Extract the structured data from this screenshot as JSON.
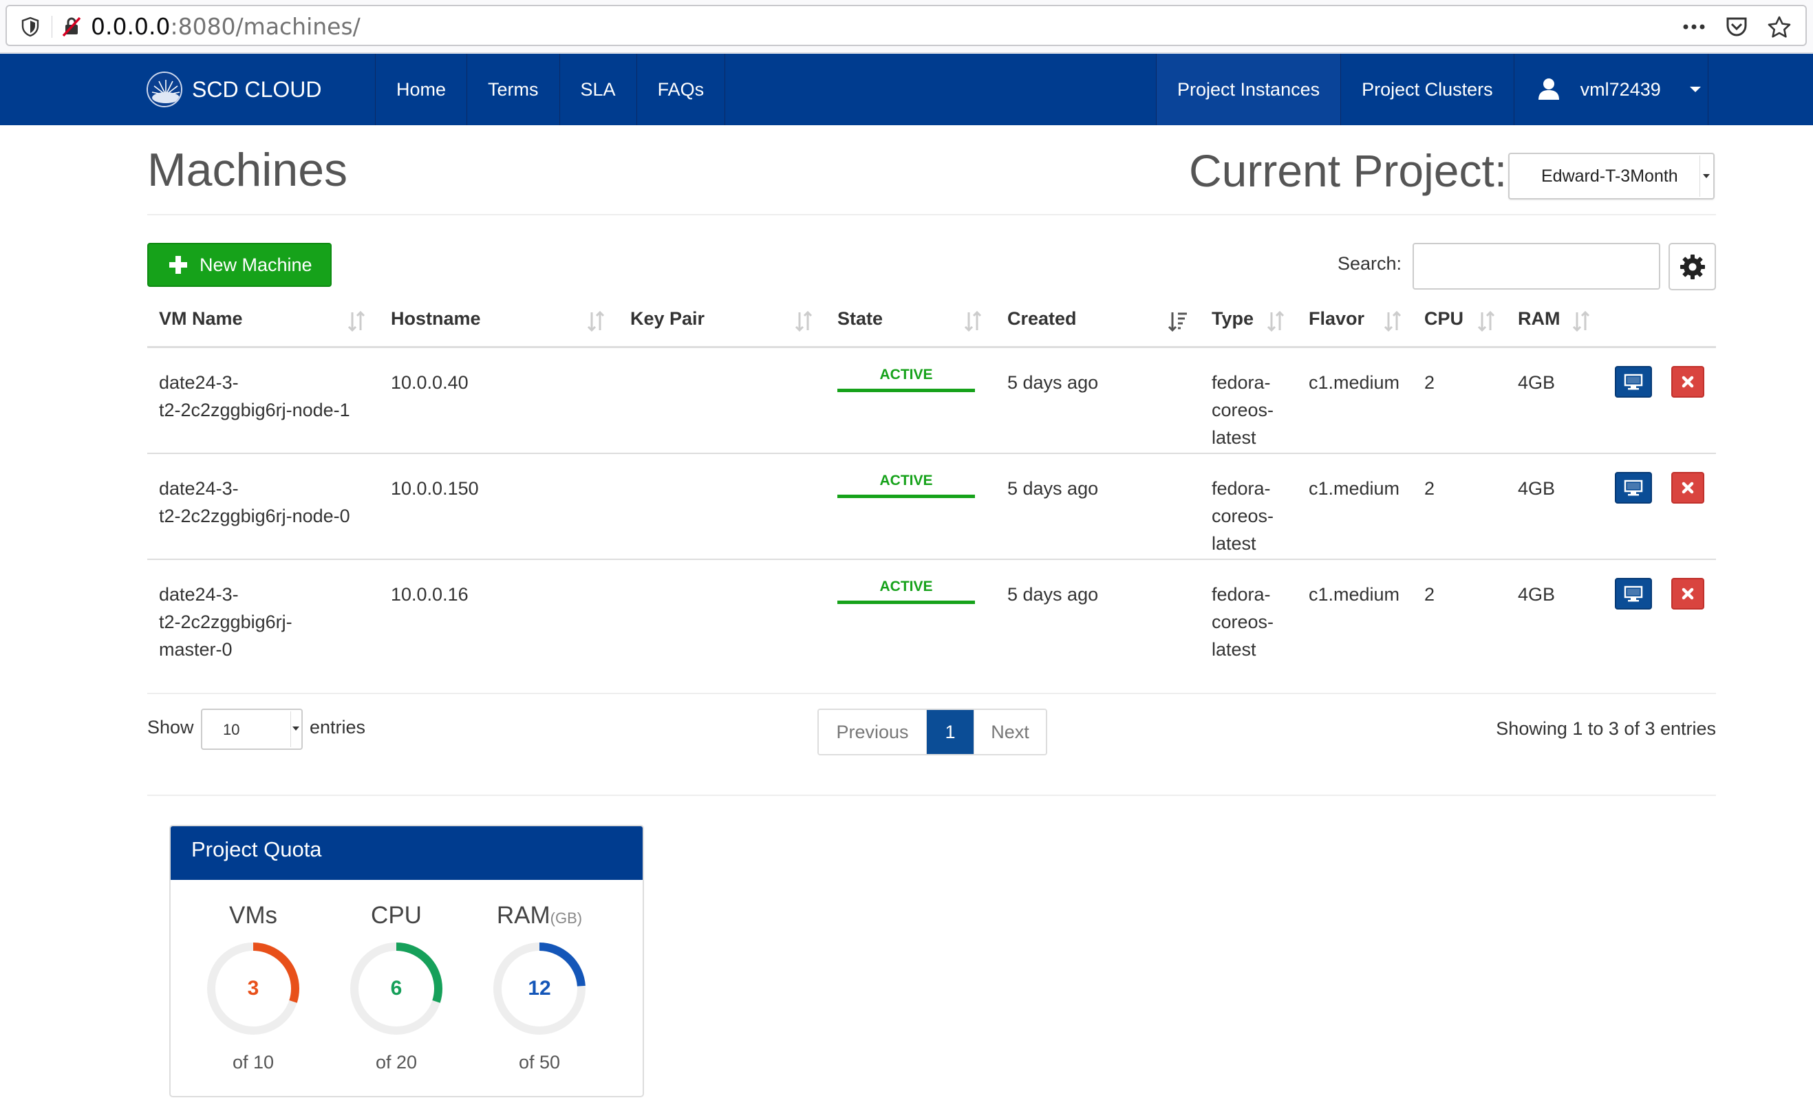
{
  "browser": {
    "url_host": "0.0.0.0",
    "url_rest": ":8080/machines/"
  },
  "navbar": {
    "brand": "SCD CLOUD",
    "left_items": [
      "Home",
      "Terms",
      "SLA",
      "FAQs"
    ],
    "right_items": [
      "Project Instances",
      "Project Clusters"
    ],
    "username": "vml72439"
  },
  "page": {
    "title": "Machines",
    "project_label": "Current Project:",
    "project_value": "Edward-T-3Month"
  },
  "toolbar": {
    "new_machine_label": "New Machine",
    "search_label": "Search:",
    "search_value": ""
  },
  "table": {
    "columns": [
      "VM Name",
      "Hostname",
      "Key Pair",
      "State",
      "Created",
      "Type",
      "Flavor",
      "CPU",
      "RAM"
    ],
    "rows": [
      {
        "vm_name": [
          "date24-3-",
          "t2-2c2zggbig6rj-node-1"
        ],
        "hostname": "10.0.0.40",
        "key_pair": "",
        "state": "ACTIVE",
        "created": "5 days ago",
        "type": [
          "fedora-",
          "coreos-",
          "latest"
        ],
        "flavor": "c1.medium",
        "cpu": "2",
        "ram": "4GB"
      },
      {
        "vm_name": [
          "date24-3-",
          "t2-2c2zggbig6rj-node-0"
        ],
        "hostname": "10.0.0.150",
        "key_pair": "",
        "state": "ACTIVE",
        "created": "5 days ago",
        "type": [
          "fedora-",
          "coreos-",
          "latest"
        ],
        "flavor": "c1.medium",
        "cpu": "2",
        "ram": "4GB"
      },
      {
        "vm_name": [
          "date24-3-",
          "t2-2c2zggbig6rj-",
          "master-0"
        ],
        "hostname": "10.0.0.16",
        "key_pair": "",
        "state": "ACTIVE",
        "created": "5 days ago",
        "type": [
          "fedora-",
          "coreos-",
          "latest"
        ],
        "flavor": "c1.medium",
        "cpu": "2",
        "ram": "4GB"
      }
    ]
  },
  "pagination": {
    "show_label": "Show",
    "page_size": "10",
    "entries_label": "entries",
    "previous": "Previous",
    "current_page": "1",
    "next": "Next",
    "info": "Showing 1 to 3 of 3 entries"
  },
  "quota": {
    "title": "Project Quota",
    "items": [
      {
        "label": "VMs",
        "unit": "",
        "used": 3,
        "total": 10,
        "used_text": "3",
        "of_text": "of 10",
        "color": "#e8501a"
      },
      {
        "label": "CPU",
        "unit": "",
        "used": 6,
        "total": 20,
        "used_text": "6",
        "of_text": "of 20",
        "color": "#16a05a"
      },
      {
        "label": "RAM",
        "unit": "(GB)",
        "used": 12,
        "total": 50,
        "used_text": "12",
        "of_text": "of 50",
        "color": "#1456b8"
      }
    ]
  },
  "colors": {
    "navbar": "#003c8f",
    "success": "#16a21a",
    "primary": "#0b4d96",
    "danger": "#d9443f"
  },
  "icons": {
    "browser": [
      "shield-icon",
      "insecure-lock-icon",
      "more-icon",
      "pocket-icon",
      "bookmark-star-icon"
    ],
    "navbar": [
      "brand-logo-icon",
      "user-icon",
      "caret-down-icon"
    ],
    "toolbar": [
      "plus-icon",
      "gear-icon"
    ],
    "row_actions": [
      "monitor-icon",
      "close-icon"
    ]
  }
}
